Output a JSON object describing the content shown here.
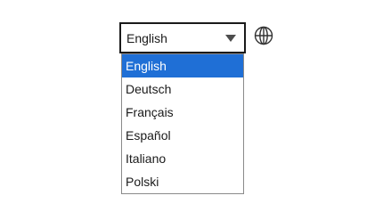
{
  "language_select": {
    "current_value": "English",
    "options": [
      {
        "label": "English",
        "selected": true
      },
      {
        "label": "Deutsch",
        "selected": false
      },
      {
        "label": "Français",
        "selected": false
      },
      {
        "label": "Español",
        "selected": false
      },
      {
        "label": "Italiano",
        "selected": false
      },
      {
        "label": "Polski",
        "selected": false
      }
    ],
    "caret_icon": "chevron-down-icon",
    "globe_icon": "globe-icon",
    "colors": {
      "border": "#1a1a1a",
      "highlight": "#1f6fd6",
      "highlight_text": "#ffffff",
      "text": "#1a1a1a"
    }
  }
}
